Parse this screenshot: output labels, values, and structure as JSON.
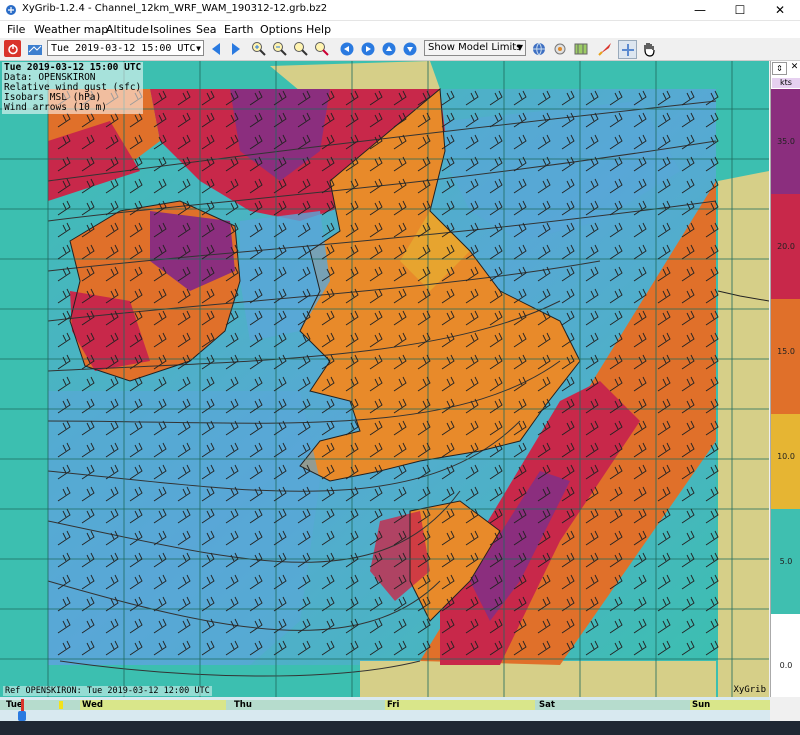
{
  "window": {
    "title": "XyGrib-1.2.4 - Channel_12km_WRF_WAM_190312-12.grb.bz2",
    "minimize_glyph": "—",
    "maximize_glyph": "☐",
    "close_glyph": "✕"
  },
  "menu": [
    "File",
    "Weather map",
    "Altitude",
    "Isolines",
    "Sea",
    "Earth",
    "Options",
    "Help"
  ],
  "toolbar": {
    "date_selector": "Tue 2019-03-12 15:00 UTC",
    "model_limits": "Show Model Limits",
    "icons": [
      "power-icon",
      "open-file-icon",
      "prev-arrow-icon",
      "next-arrow-icon",
      "zoom-in-icon",
      "zoom-out-icon",
      "zoom-selection-icon",
      "zoom-all-icon",
      "pan-left-icon",
      "pan-right-icon",
      "pan-up-icon",
      "pan-down-icon",
      "globe-icon",
      "station-icon",
      "map-icon",
      "launch-icon",
      "crosshair-icon",
      "hand-icon"
    ]
  },
  "map_overlay": {
    "line1": "Tue 2019-03-12 15:00 UTC",
    "line2": "Data: OPENSKIRON",
    "line3": "Relative wind gust (sfc)",
    "line4": "Isobars MSL (hPa)",
    "line5": "Wind arrows (10 m)"
  },
  "footer": {
    "ref": "Ref OPENSKIRON: Tue 2019-03-12 12:00 UTC",
    "brand": "XyGrib"
  },
  "legend": {
    "unit": "kts",
    "bands": [
      {
        "label": "35.0",
        "color": "#8b2e7e"
      },
      {
        "label": "20.0",
        "color": "#c8284a"
      },
      {
        "label": "15.0",
        "color": "#e0702a"
      },
      {
        "label": "10.0",
        "color": "#e6b533"
      },
      {
        "label": "5.0",
        "color": "#3fbfb0"
      },
      {
        "label": "0.0",
        "color": "#ffffff"
      }
    ]
  },
  "timeline": {
    "days": [
      "Tue",
      "Wed",
      "Thu",
      "Fri",
      "Sat",
      "Sun"
    ]
  },
  "colors": {
    "sea_low": "#3cbfb0",
    "sea_mid": "#5aa6d8",
    "land": "#d6cf88",
    "grid": "#1d6a5e",
    "isobar": "#333333",
    "orange": "#e88a2a",
    "red": "#c8284a",
    "purple": "#8b2e7e"
  }
}
